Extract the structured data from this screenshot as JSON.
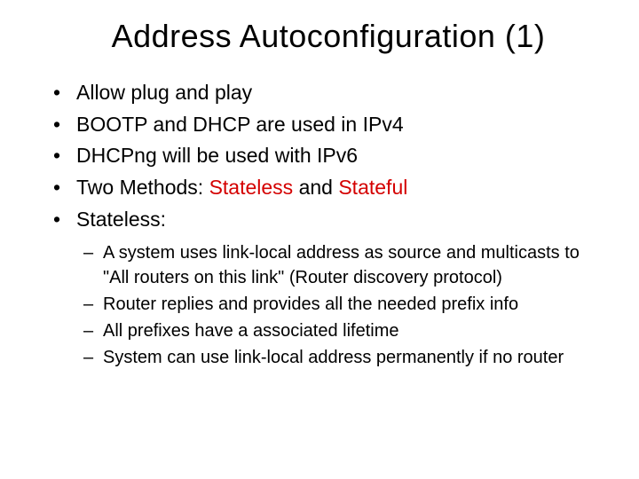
{
  "title": "Address Autoconfiguration (1)",
  "bullets": {
    "b1": "Allow plug and play",
    "b2_pre": "BOOTP and DHCP are used in IPv",
    "b2_num": "4",
    "b3_pre": "DHCPng will be used with IPv",
    "b3_num": "6",
    "b4_pre": "Two Methods: ",
    "b4_red1": "Stateless",
    "b4_mid": " and ",
    "b4_red2": "Stateful",
    "b5": "Stateless:"
  },
  "sub": {
    "s1": "A system uses link-local address as source and multicasts to \"All routers on this link\" (Router discovery protocol)",
    "s2": "Router replies and provides all the needed prefix info",
    "s3": "All prefixes have a associated lifetime",
    "s4": "System can use link-local address permanently if no router"
  }
}
